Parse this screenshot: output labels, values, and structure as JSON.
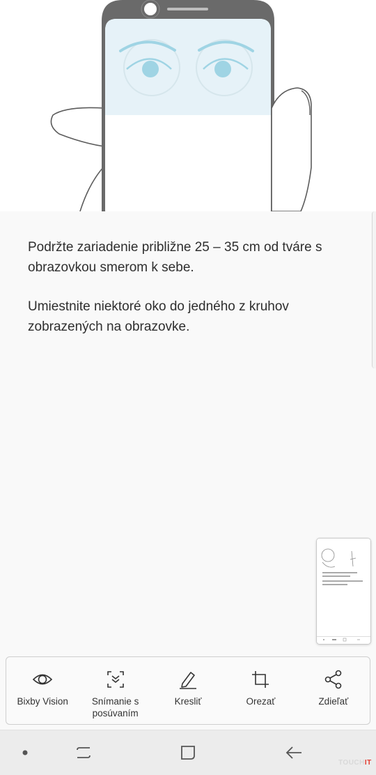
{
  "instructions": {
    "paragraph_1": "Podržte zariadenie približne 25 – 35 cm od tváre s obrazovkou smerom k sebe.",
    "paragraph_2": "Umiestnite niektoré oko do jedného z kruhov zobrazených na obrazovke."
  },
  "toolbar": {
    "items": [
      {
        "label": "Bixby Vision",
        "icon": "eye-icon"
      },
      {
        "label": "Snímanie s posúvaním",
        "icon": "scroll-capture-icon"
      },
      {
        "label": "Kresliť",
        "icon": "pencil-icon"
      },
      {
        "label": "Orezať",
        "icon": "crop-icon"
      },
      {
        "label": "Zdieľať",
        "icon": "share-icon"
      }
    ]
  },
  "navigation": {
    "buttons": [
      "dot-indicator",
      "recent-apps-icon",
      "home-icon",
      "back-icon"
    ]
  },
  "watermark": {
    "prefix": "TOUCH",
    "suffix": "IT"
  },
  "colors": {
    "eye_tint": "#9fd4e4",
    "screen_tint": "#e6f2f8",
    "phone_frame": "#6a6a6a",
    "background": "#f9f9f9",
    "nav_bar": "#ececec"
  }
}
